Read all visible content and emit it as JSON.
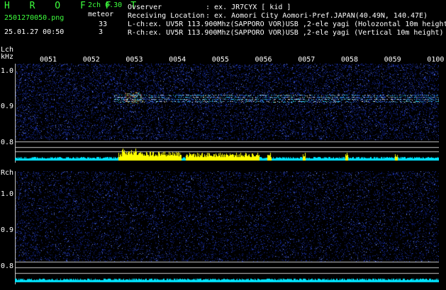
{
  "header": {
    "brand": "H R O F F T",
    "filename": "2501270050.png",
    "datetime": "25.01.27 00:50",
    "mode": "2ch 0.30",
    "meteor_label": "meteor",
    "lch_count": "33",
    "rch_count": "3",
    "observer_label": "Ovserver",
    "observer_value": ": ex. JR7CYX [ kid ]",
    "location_label": "Receiving Location",
    "location_value": ": ex. Aomori City Aomori-Pref.JAPAN(40.49N, 140.47E)",
    "lch_desc": "L-ch:ex. UV5R 113.900Mhz(SAPPORO VOR)USB ,2-ele yagi (Holozontal 10m height",
    "rch_desc": "R-ch:ex. UV5R 113.900Mhz(SAPPORO VOR)USB ,2-ele yagi (Vertical 10m height)"
  },
  "time_ticks": [
    "0051",
    "0052",
    "0053",
    "0054",
    "0055",
    "0056",
    "0057",
    "0058",
    "0059",
    "0100"
  ],
  "lch": {
    "label": "Lch",
    "unit": "kHz",
    "freq_ticks": [
      "1.0",
      "0.9",
      "0.8"
    ]
  },
  "rch": {
    "label": "Rch",
    "freq_ticks": [
      "1.0",
      "0.9",
      "0.8"
    ]
  },
  "colors": {
    "background": "#000000",
    "noise_blue": "#1a2fa8",
    "level_cyan": "#00e5ff",
    "meteor_yellow": "#ffff00",
    "text_green": "#3dff3d"
  }
}
